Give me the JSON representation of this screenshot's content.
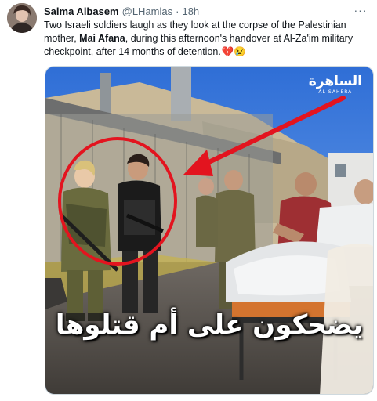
{
  "tweet": {
    "author_name": "Salma Albasem",
    "author_handle": "@LHamlas",
    "time_separator": "·",
    "time": "18h",
    "more_label": "···",
    "text_part1": "Two Israeli soldiers laugh as they look at the corpse of the Palestinian mother, ",
    "text_bold": "Mai Afana",
    "text_part2": ", during this afternoon's handover at Al-Za'im military checkpoint, after 14 months of detention.",
    "text_emoji": "💔😢"
  },
  "media": {
    "watermark_arabic": "الساهرة",
    "watermark_latin": "AL-SAHERA",
    "caption_arabic": "يضحكون على أم قتلوها",
    "highlight_color": "#e3141f",
    "icons": [
      "red-circle-highlight",
      "red-arrow"
    ]
  }
}
